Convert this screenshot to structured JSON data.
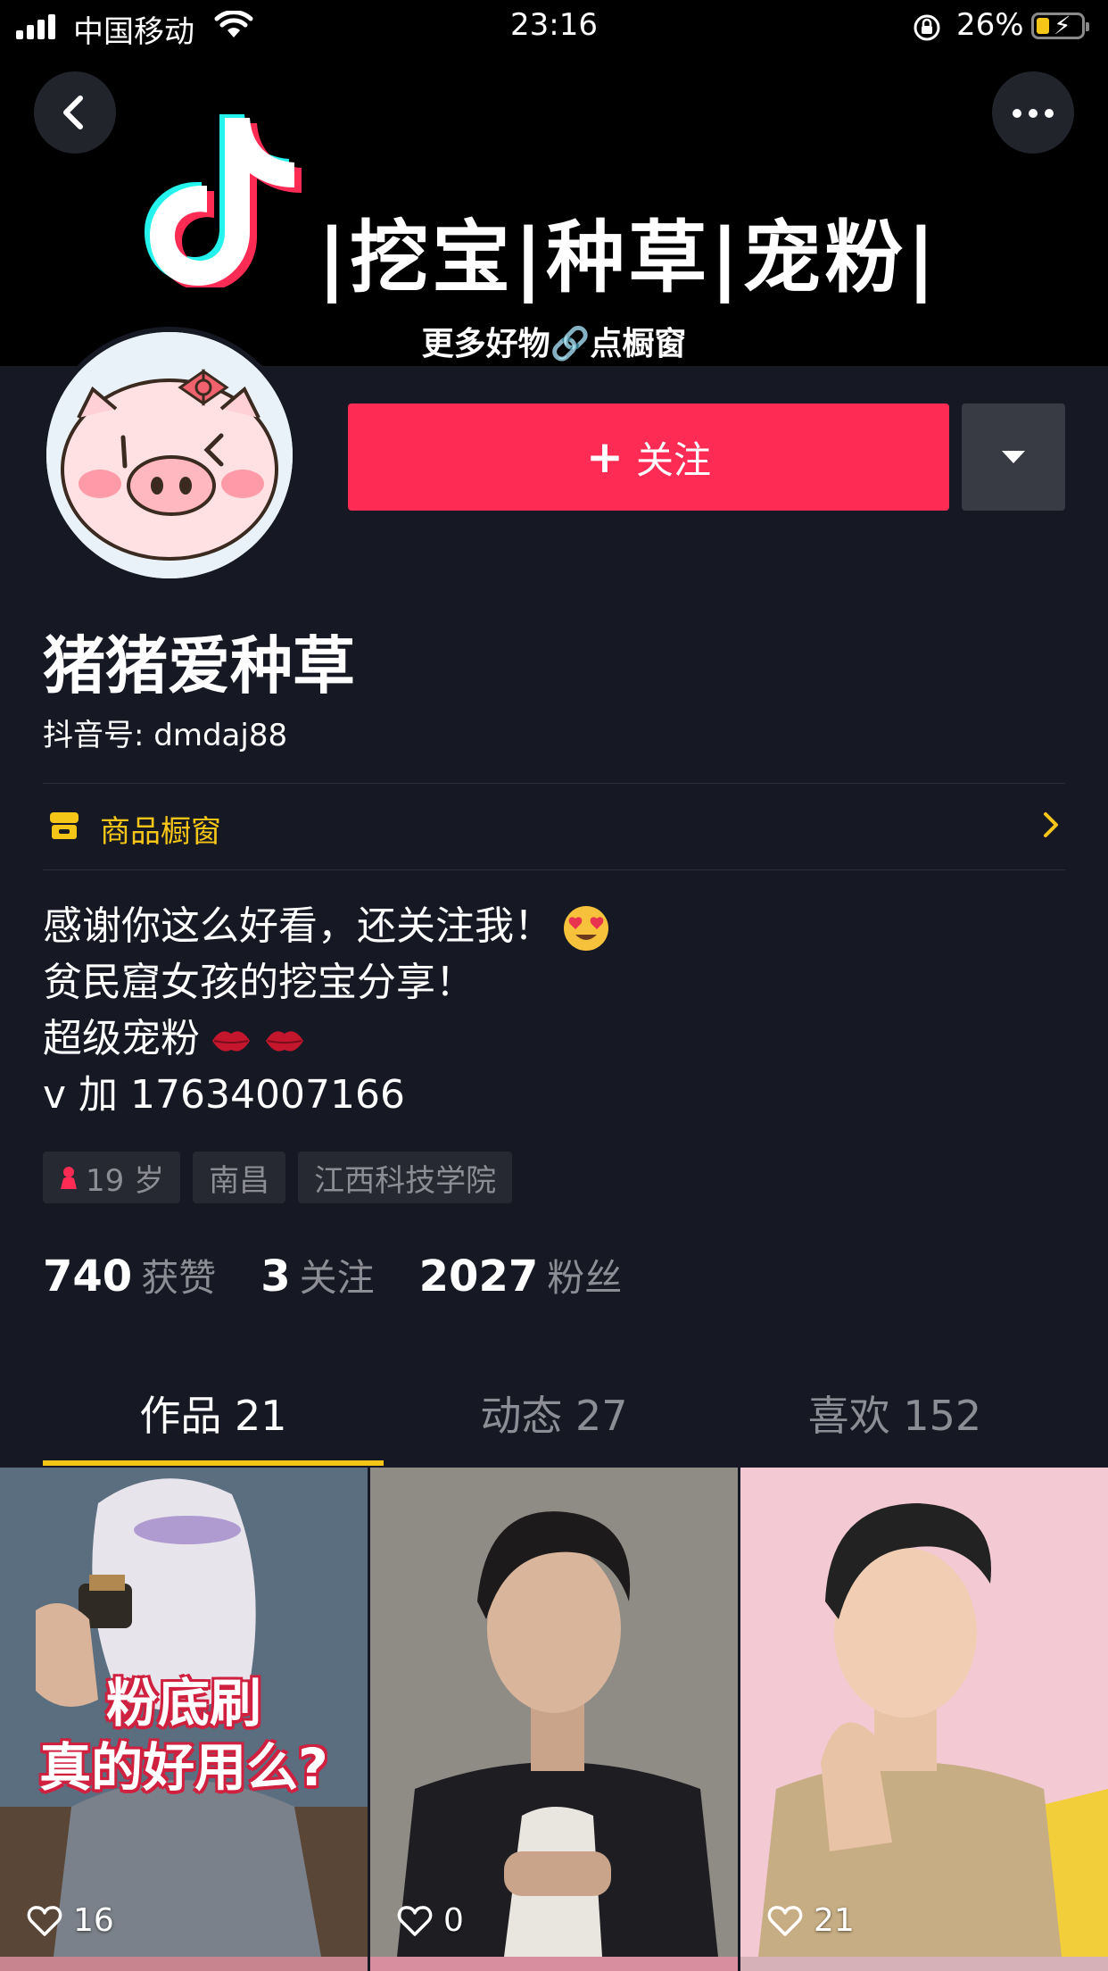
{
  "status_bar": {
    "carrier": "中国移动",
    "time": "23:16",
    "battery": "26%"
  },
  "banner": {
    "title": "|挖宝|种草|宠粉|",
    "subtitle": "更多好物🔗点橱窗"
  },
  "profile": {
    "follow_label": "关注",
    "nickname": "猪猪爱种草",
    "douyin_id": "抖音号: dmdaj88",
    "shop_label": "商品橱窗",
    "bio": [
      "感谢你这么好看，还关注我！",
      "贫民窟女孩的挖宝分享！",
      "超级宠粉",
      "v 加 17634007166"
    ],
    "tags": [
      "19 岁",
      "南昌",
      "江西科技学院"
    ],
    "stats": [
      {
        "num": "740",
        "label": "获赞"
      },
      {
        "num": "3",
        "label": "关注"
      },
      {
        "num": "2027",
        "label": "粉丝"
      }
    ]
  },
  "tabs": [
    {
      "label": "作品 21"
    },
    {
      "label": "动态 27"
    },
    {
      "label": "喜欢 152"
    }
  ],
  "videos": [
    {
      "cover_text": [
        "粉底刷",
        "真的好用么?"
      ],
      "likes": "16"
    },
    {
      "likes": "0"
    },
    {
      "likes": "21"
    }
  ],
  "colors": {
    "background": "#161823",
    "follow": "#fe2c55",
    "accent": "#f5c518",
    "muted": "#8d8e95"
  }
}
